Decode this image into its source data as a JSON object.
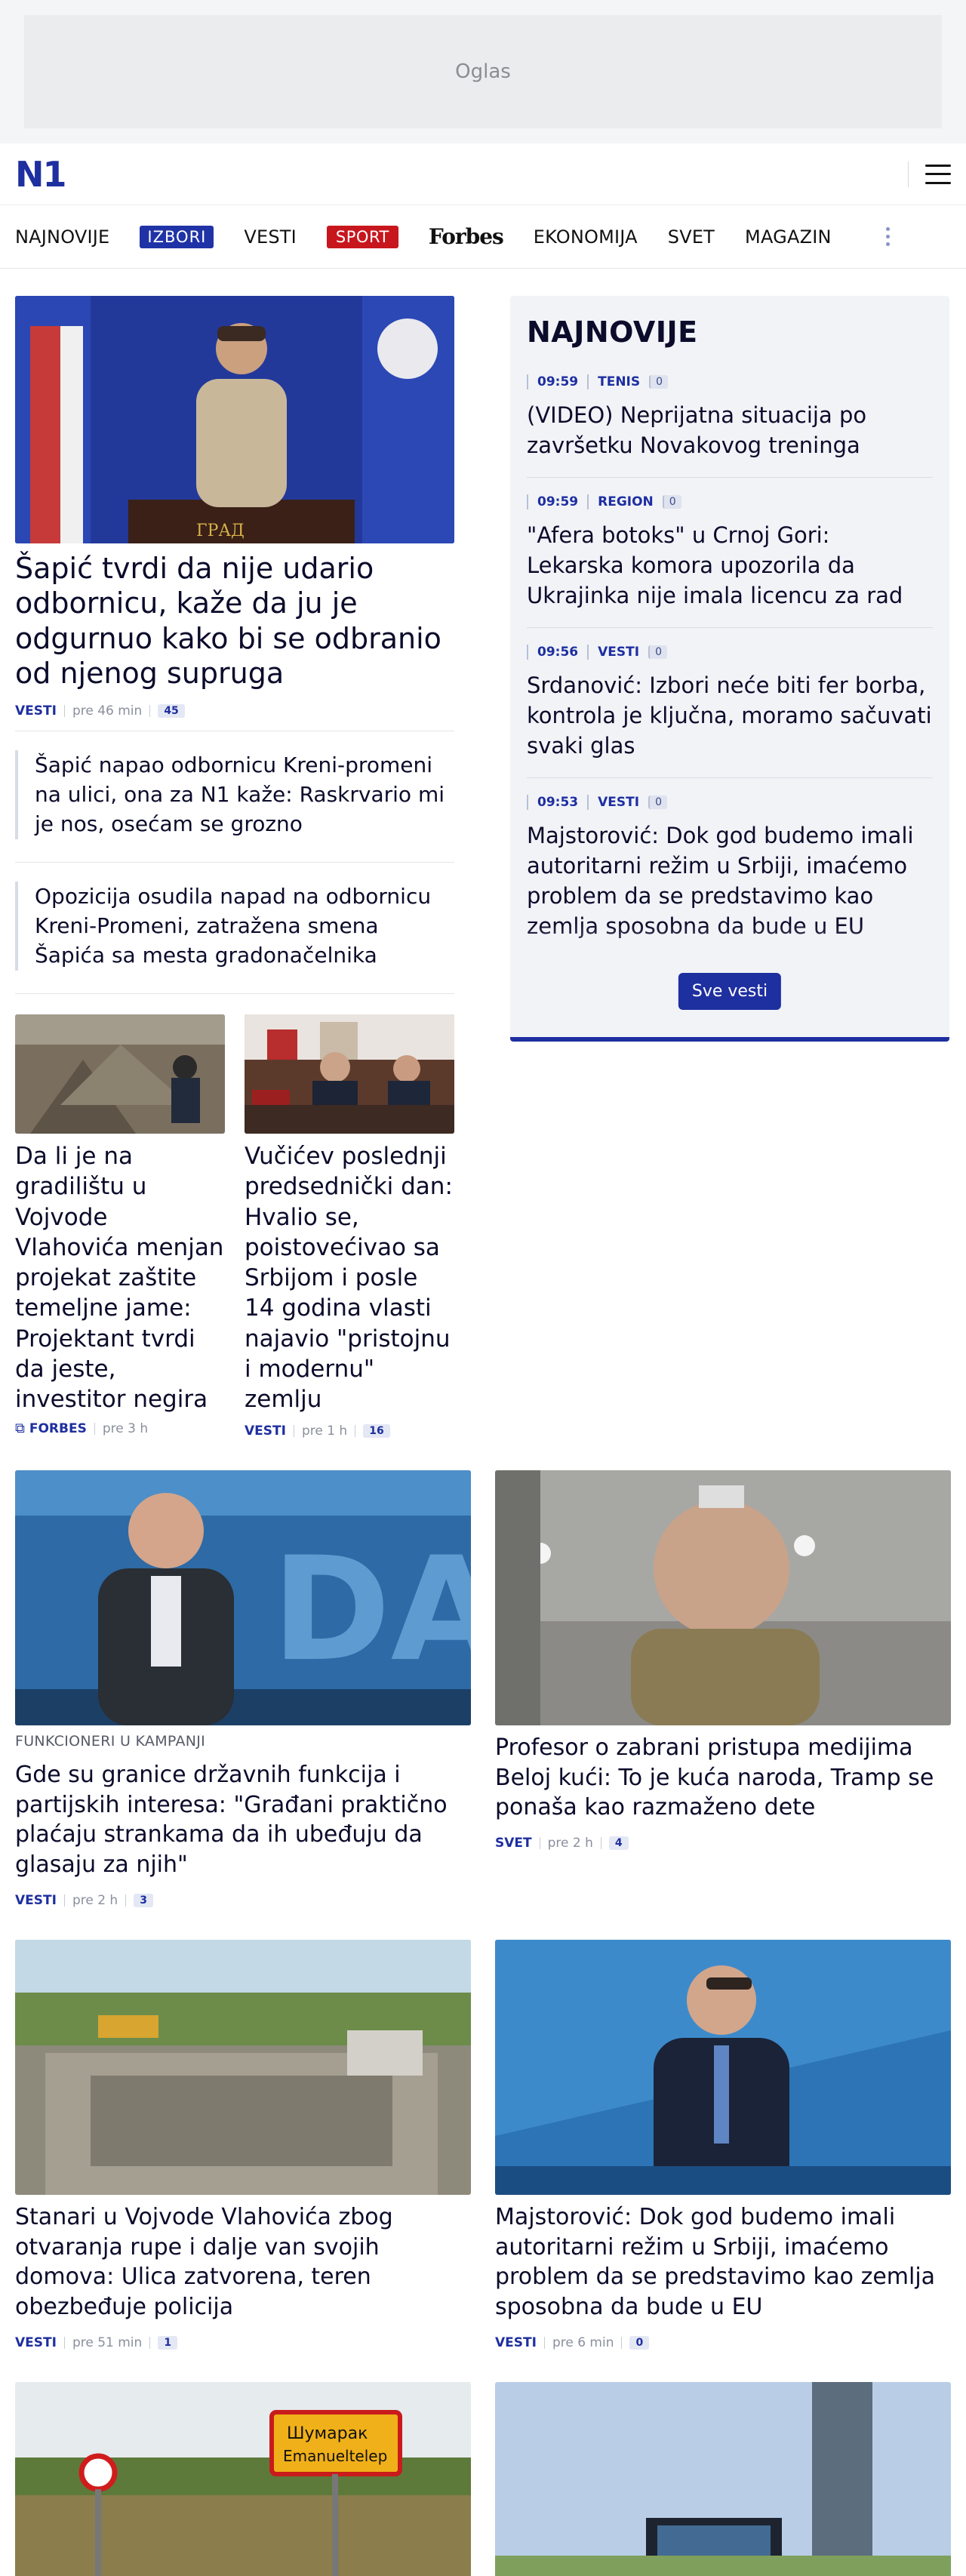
{
  "ad": {
    "label": "Oglas"
  },
  "brand": {
    "logo": "N1"
  },
  "nav": {
    "items": [
      "NAJNOVIJE",
      "IZBORI",
      "VESTI",
      "SPORT",
      "Forbes",
      "EKONOMIJA",
      "SVET",
      "MAGAZIN"
    ]
  },
  "lead": {
    "title": "Šapić tvrdi da nije udario odbornicu, kaže da ju je odgurnuo kako bi se odbranio od njenog supruga",
    "category": "VESTI",
    "time": "pre 46 min",
    "comments": "45",
    "related": [
      "Šapić napao odbornicu Kreni-promeni na ulici, ona za N1 kaže: Raskrvario mi je nos, osećam se grozno",
      "Opozicija osudila napad na odbornicu Kreni-Promeni, zatražena smena Šapića sa mesta gradonačelnika"
    ]
  },
  "small_cards": [
    {
      "title": "Da li je na gradilištu u Vojvode Vlahovića menjan projekat zaštite temeljne jame: Projektant tvrdi da jeste, investitor negira",
      "category": "FORBES",
      "time": "pre 3 h",
      "comments": ""
    },
    {
      "title": "Vučićev poslednji predsednički dan: Hvalio se, poistovećivao sa Srbijom i posle 14 godina vlasti najavio \"pristojnu i modernu\" zemlju",
      "category": "VESTI",
      "time": "pre 1 h",
      "comments": "16"
    }
  ],
  "sidebar": {
    "title": "NAJNOVIJE",
    "items": [
      {
        "time": "09:59",
        "category": "TENIS",
        "comments": "0",
        "text": "(VIDEO) Neprijatna situacija po završetku Novakovog treninga"
      },
      {
        "time": "09:59",
        "category": "REGION",
        "comments": "0",
        "text": "\"Afera botoks\" u Crnoj Gori: Lekarska komora upozorila da Ukrajinka nije imala licencu za rad"
      },
      {
        "time": "09:56",
        "category": "VESTI",
        "comments": "0",
        "text": "Srdanović: Izbori neće biti fer borba, kontrola je ključna, moramo sačuvati svaki glas"
      },
      {
        "time": "09:53",
        "category": "VESTI",
        "comments": "0",
        "text": "Majstorović: Dok god budemo imali autoritarni režim u Srbiji, imaćemo problem da se predstavimo kao zemlja sposobna da bude u EU"
      }
    ],
    "button": "Sve vesti"
  },
  "grid": [
    {
      "kicker": "FUNKCIONERI U KAMPANJI",
      "title": "Gde su granice državnih funkcija i partijskih interesa: \"Građani praktično plaćaju strankama da ih ubeđuju da glasaju za njih\"",
      "category": "VESTI",
      "time": "pre 2 h",
      "comments": "3"
    },
    {
      "kicker": "",
      "title": "Profesor o zabrani pristupa medijima Beloj kući: To je kuća naroda, Tramp se ponaša kao razmaženo dete",
      "category": "SVET",
      "time": "pre 2 h",
      "comments": "4"
    },
    {
      "kicker": "",
      "title": "Stanari u Vojvode Vlahovića zbog otvaranja rupe i dalje van svojih domova: Ulica zatvorena, teren obezbeđuje policija",
      "category": "VESTI",
      "time": "pre 51 min",
      "comments": "1"
    },
    {
      "kicker": "",
      "title": "Majstorović: Dok god budemo imali autoritarni režim u Srbiji, imaćemo problem da se predstavimo kao zemlja sposobna da bude u EU",
      "category": "VESTI",
      "time": "pre 6 min",
      "comments": "0"
    }
  ],
  "signs": {
    "town_cyr": "Шумарак",
    "town_lat": "Emanueltelep"
  },
  "colors": {
    "brand": "#1e2fa0",
    "sport": "#c8161d",
    "sidebar_bg": "#f1f3f7"
  }
}
